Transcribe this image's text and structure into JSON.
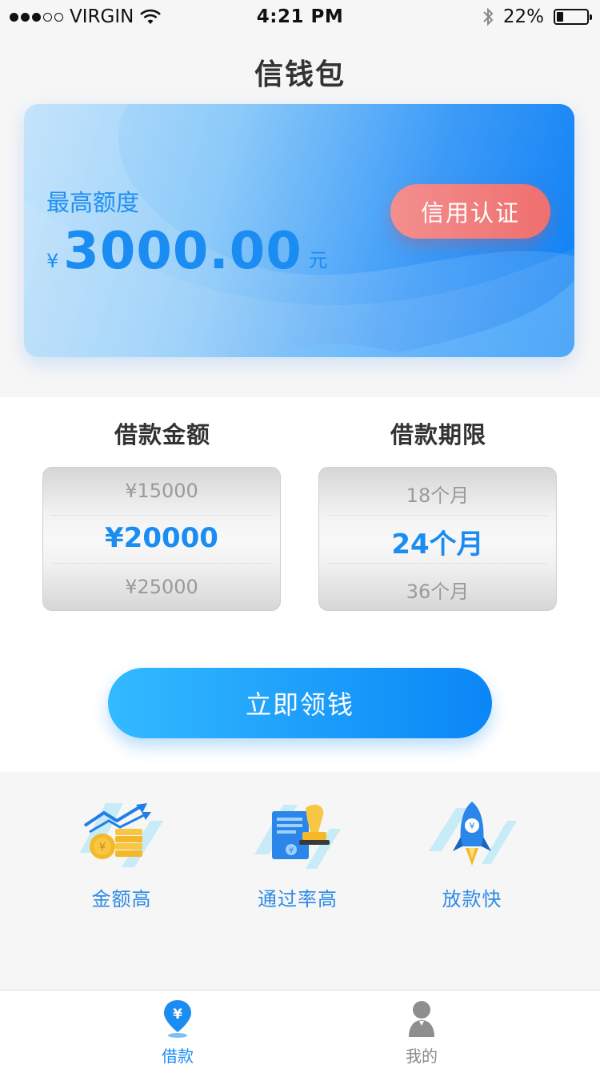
{
  "status_bar": {
    "carrier": "VIRGIN",
    "time": "4:21 PM",
    "battery": "22%",
    "battery_level": 0.22,
    "signal_bars_filled": 3,
    "signal_bars_total": 5
  },
  "header": {
    "title": "信钱包"
  },
  "credit_card": {
    "label": "最高额度",
    "currency_symbol": "¥",
    "amount": "3000.00",
    "unit": "元",
    "credit_button": "信用认证"
  },
  "loan_amount": {
    "title": "借款金额",
    "options": [
      "¥15000",
      "¥20000",
      "¥25000"
    ],
    "selected_index": 1
  },
  "loan_term": {
    "title": "借款期限",
    "options": [
      "18个月",
      "24个月",
      "36个月"
    ],
    "selected_index": 1
  },
  "main_button": "立即领钱",
  "features": [
    {
      "label": "金额高",
      "icon": "coins-chart-icon"
    },
    {
      "label": "通过率高",
      "icon": "document-stamp-icon"
    },
    {
      "label": "放款快",
      "icon": "rocket-icon"
    }
  ],
  "tabs": [
    {
      "label": "借款",
      "icon": "location-yen-icon",
      "active": true
    },
    {
      "label": "我的",
      "icon": "user-icon",
      "active": false
    }
  ],
  "colors": {
    "accent": "#1a8cf2",
    "credit_button": "#f07a7a",
    "inactive": "#8a8a8a"
  }
}
